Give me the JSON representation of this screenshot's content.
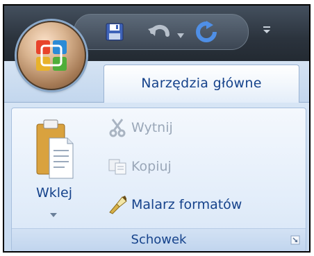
{
  "quick_access": {
    "save_icon": "save-icon",
    "undo_icon": "undo-icon",
    "redo_icon": "redo-icon",
    "customize_icon": "customize-qat-icon"
  },
  "office_button": {
    "icon": "office-logo-icon"
  },
  "tabs": [
    {
      "label": "Narzędzia główne",
      "active": true
    }
  ],
  "clipboard_group": {
    "label": "Schowek",
    "paste": {
      "label": "Wklej",
      "icon": "paste-icon"
    },
    "cut": {
      "label": "Wytnij",
      "icon": "scissors-icon",
      "enabled": false
    },
    "copy": {
      "label": "Kopiuj",
      "icon": "copy-icon",
      "enabled": false
    },
    "format_painter": {
      "label": "Malarz formatów",
      "icon": "format-painter-icon",
      "enabled": true
    }
  },
  "colors": {
    "ribbon_text": "#15428b",
    "disabled_text": "#9aa7b8",
    "title_bar": "#2b333d"
  }
}
